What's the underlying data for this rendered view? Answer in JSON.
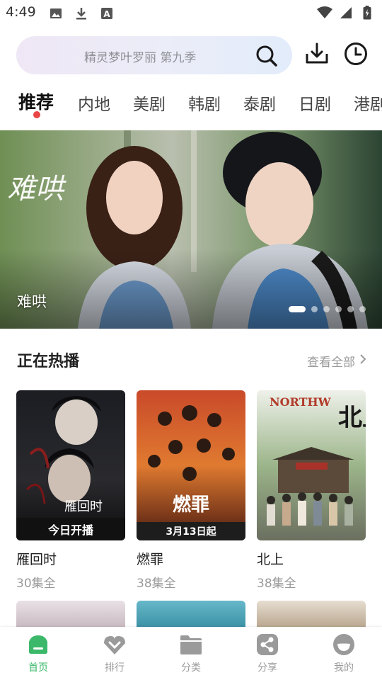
{
  "status_bar": {
    "time": "4:49",
    "icons_left": [
      "image-icon",
      "download-icon",
      "a-icon"
    ],
    "icons_right": [
      "wifi-icon",
      "signal-icon",
      "battery-icon"
    ]
  },
  "search": {
    "placeholder": "精灵梦叶罗丽 第九季"
  },
  "header_actions": [
    "download-icon",
    "history-icon"
  ],
  "tabs": [
    {
      "label": "推荐",
      "active": true
    },
    {
      "label": "内地"
    },
    {
      "label": "美剧"
    },
    {
      "label": "韩剧"
    },
    {
      "label": "泰剧"
    },
    {
      "label": "日剧"
    },
    {
      "label": "港剧"
    }
  ],
  "banner": {
    "calligraphy": "难哄",
    "caption": "难哄",
    "slides": 6,
    "active_slide": 1
  },
  "section": {
    "title": "正在热播",
    "see_all": "查看全部"
  },
  "cards": [
    {
      "title": "雁回时",
      "subtitle": "30集全",
      "poster_tag": "今日开播"
    },
    {
      "title": "燃罪",
      "subtitle": "38集全",
      "poster_tag": "3月13日起"
    },
    {
      "title": "北上",
      "subtitle": "38集全",
      "poster_tag": ""
    }
  ],
  "bottom_nav": [
    {
      "label": "首页",
      "icon": "home-icon",
      "active": true
    },
    {
      "label": "排行",
      "icon": "ranking-icon"
    },
    {
      "label": "分类",
      "icon": "folder-icon"
    },
    {
      "label": "分享",
      "icon": "share-icon"
    },
    {
      "label": "我的",
      "icon": "profile-icon"
    }
  ],
  "colors": {
    "accent_green": "#3bb86a",
    "tab_dot": "#e84545",
    "muted_text": "#999999"
  }
}
